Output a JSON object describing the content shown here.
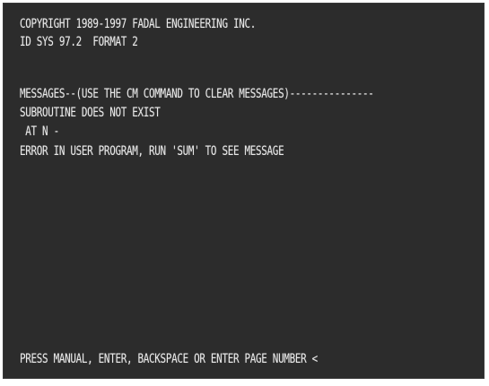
{
  "terminal": {
    "copyright": "COPYRIGHT 1989-1997 FADAL ENGINEERING INC.",
    "system_id": "ID SYS 97.2  FORMAT 2",
    "messages_header": "MESSAGES--(USE THE CM COMMAND TO CLEAR MESSAGES)---------------",
    "message_1": "SUBROUTINE DOES NOT EXIST",
    "message_2": " AT N -",
    "message_3": "ERROR IN USER PROGRAM, RUN 'SUM' TO SEE MESSAGE",
    "prompt": "PRESS MANUAL, ENTER, BACKSPACE OR ENTER PAGE NUMBER <"
  },
  "colors": {
    "background": "#2c2c2c",
    "text": "#e9e9e9"
  }
}
